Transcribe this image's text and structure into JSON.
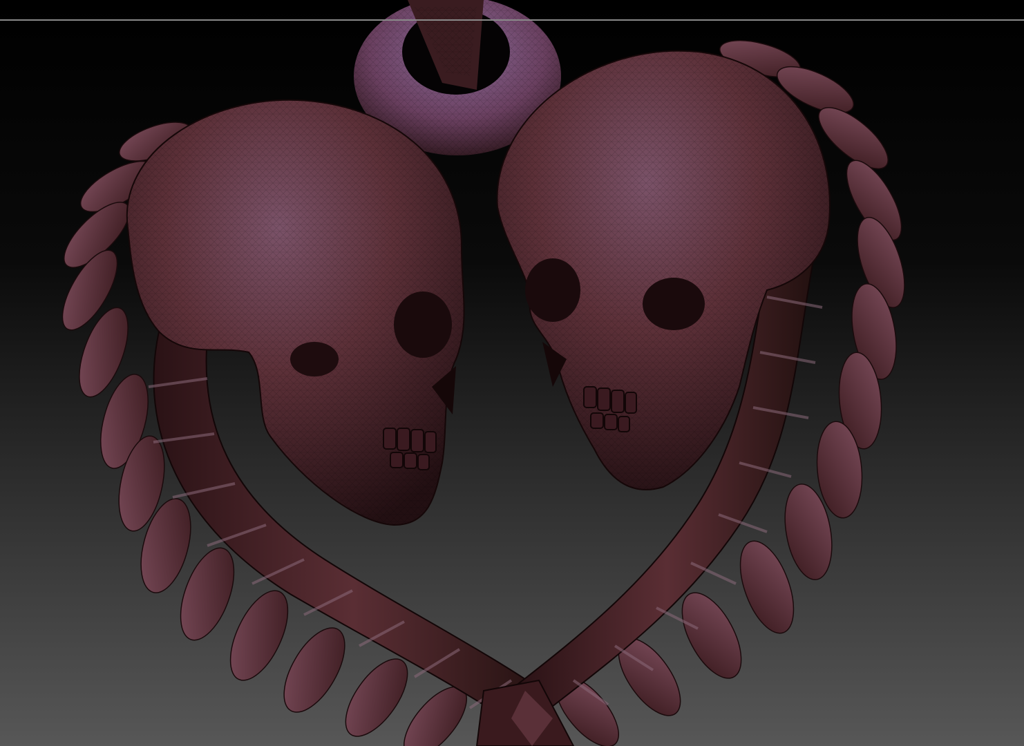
{
  "viewport": {
    "background_top": "#000000",
    "background_bottom": "#555555",
    "frame_line_color": "#8a8a8a"
  },
  "model": {
    "description_icon": "skull-heart-pendant-icon",
    "material_base": "#5a2e2e",
    "material_highlight": "#7e5a78",
    "material_shadow": "#1e0d0f",
    "wireframe": true
  }
}
